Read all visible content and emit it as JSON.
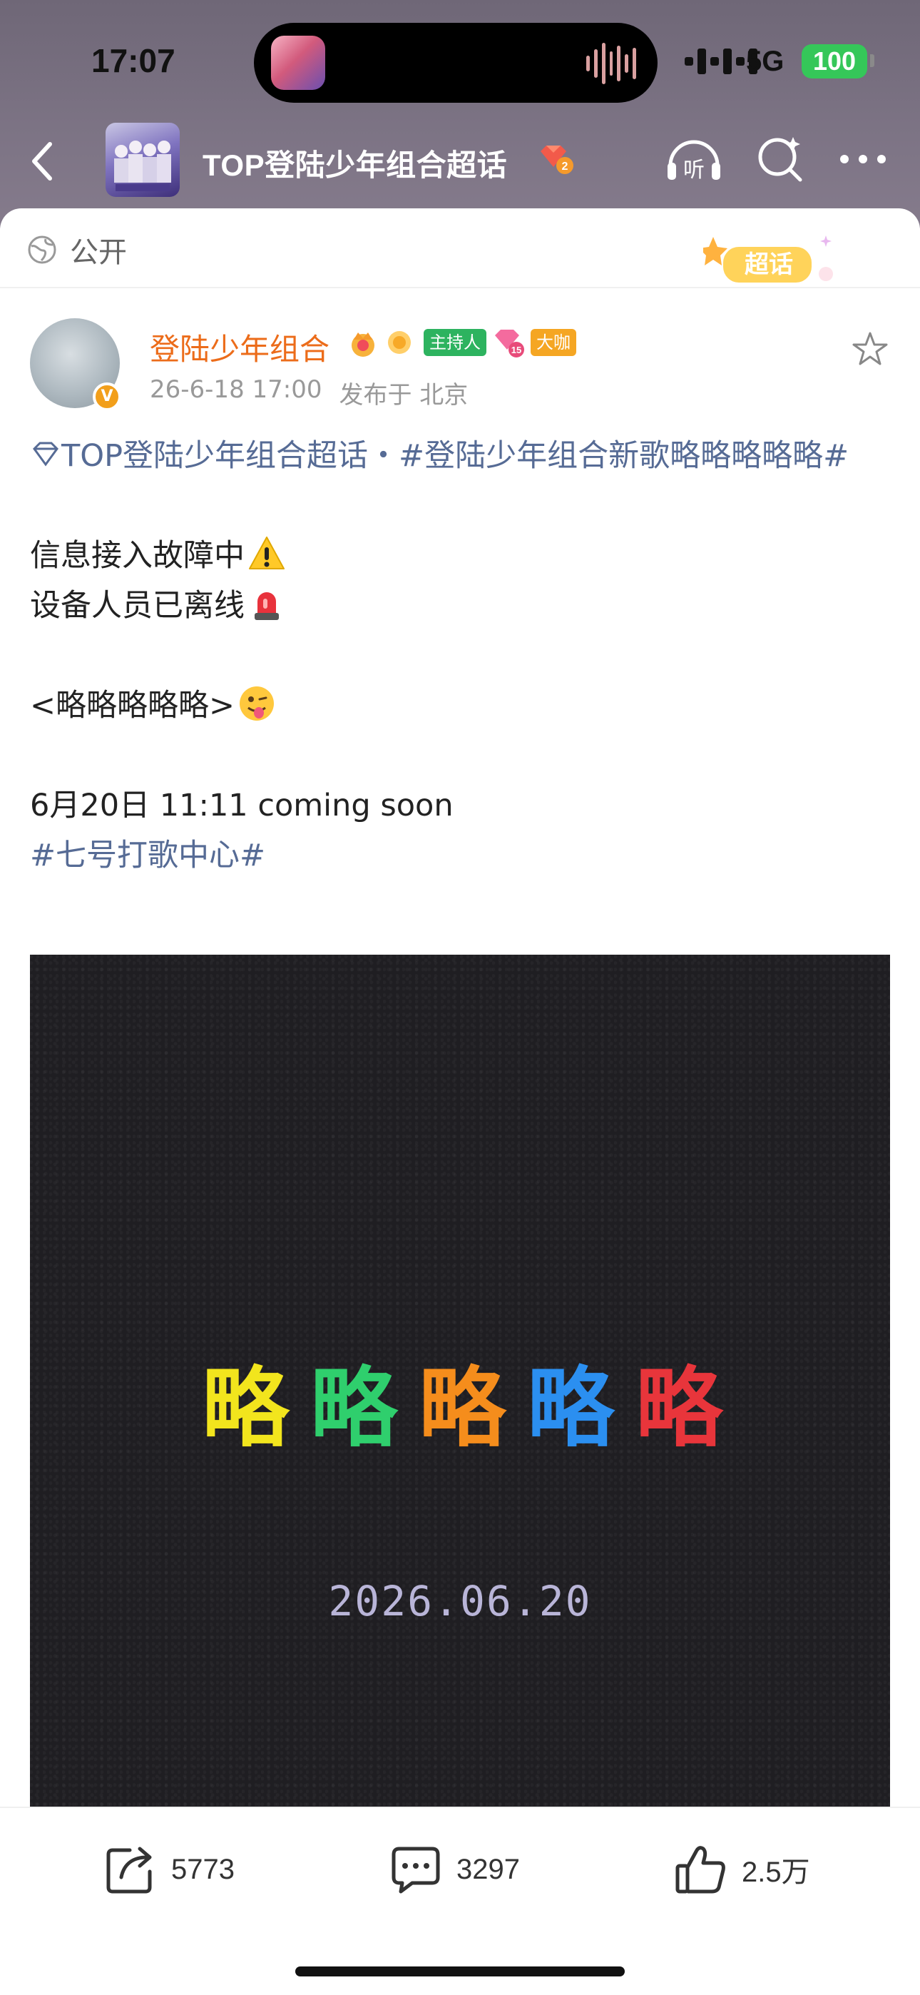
{
  "status_bar": {
    "time": "17:07",
    "network": "5G",
    "battery": "100"
  },
  "nav": {
    "title": "TOP登陆少年组合超话",
    "icons": [
      "back-icon",
      "listen-icon",
      "search-icon",
      "more-icon"
    ],
    "listen_label": "听"
  },
  "visibility": {
    "label": "公开",
    "chaohua_label": "超话"
  },
  "post": {
    "author": "登陆少年组合",
    "badges": {
      "host": "主持人",
      "gem_level": "15",
      "big": "大咖"
    },
    "timestamp": "26-6-18 17:00",
    "location": "发布于 北京",
    "lines": {
      "tag_line": "TOP登陆少年组合超话・#登陆少年组合新歌略略略略略#",
      "l1": "信息接入故障中",
      "l2": "设备人员已离线",
      "l3": "<略略略略略>",
      "l4": "6月20日 11:11 coming soon",
      "l5": "#七号打歌中心#"
    },
    "image": {
      "title_glyphs": [
        "略",
        "略",
        "略",
        "略",
        "略"
      ],
      "title_colors": [
        "#f2e51d",
        "#2fcf6d",
        "#f58d1c",
        "#2b8ff0",
        "#e8353b"
      ],
      "date": "2026.06.20"
    }
  },
  "actions": {
    "share_count": "5773",
    "comment_count": "3297",
    "like_count": "2.5万"
  }
}
